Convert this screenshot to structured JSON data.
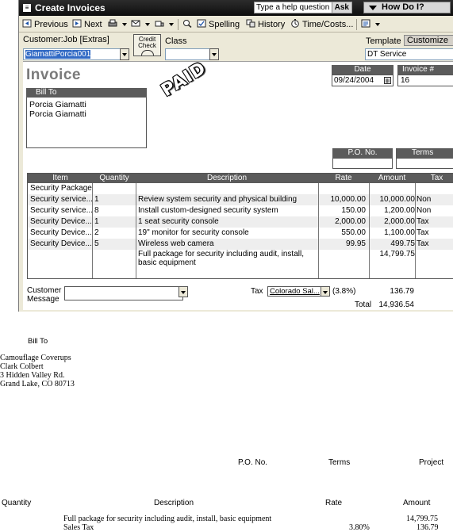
{
  "window": {
    "title": "Create Invoices",
    "help_placeholder": "Type a help question",
    "ask_label": "Ask",
    "how_do_i_label": "How Do I?"
  },
  "toolbar": {
    "previous_label": "Previous",
    "next_label": "Next",
    "spelling_label": "Spelling",
    "history_label": "History",
    "time_costs_label": "Time/Costs..."
  },
  "header": {
    "customer_job_label": "Customer:Job",
    "extras_label": "[Extras]",
    "class_label": "Class",
    "template_label": "Template",
    "template_button": "Customize",
    "customer_job_value": "GiamattiPorcia001",
    "class_value": "",
    "template_value": "DT Service",
    "credit_check_label": "Credit Check"
  },
  "form": {
    "title": "Invoice",
    "stamp": "PAID",
    "bill_to_label": "Bill To",
    "bill_to_lines": [
      "Porcia Giamatti",
      "Porcia Giamatti"
    ],
    "date_label": "Date",
    "date_value": "09/24/2004",
    "invoice_no_label": "Invoice #",
    "invoice_no_value": "16",
    "po_label": "P.O. No.",
    "terms_label": "Terms"
  },
  "grid": {
    "headers": {
      "item": "Item",
      "quantity": "Quantity",
      "description": "Description",
      "rate": "Rate",
      "amount": "Amount",
      "tax": "Tax"
    },
    "rows": [
      {
        "item": "Security Package",
        "qty": "",
        "desc": "",
        "rate": "",
        "amount": "",
        "tax": ""
      },
      {
        "item": "Security service...",
        "qty": "1",
        "desc": "Review system security and physical building",
        "rate": "10,000.00",
        "amount": "10,000.00",
        "tax": "Non"
      },
      {
        "item": "Security service...",
        "qty": "8",
        "desc": "Install custom-designed security system",
        "rate": "150.00",
        "amount": "1,200.00",
        "tax": "Non"
      },
      {
        "item": "Security Device...",
        "qty": "1",
        "desc": "1 seat security console",
        "rate": "2,000.00",
        "amount": "2,000.00",
        "tax": "Tax"
      },
      {
        "item": "Security Device...",
        "qty": "2",
        "desc": "19\" monitor for security console",
        "rate": "550.00",
        "amount": "1,100.00",
        "tax": "Tax"
      },
      {
        "item": "Security Device...",
        "qty": "5",
        "desc": "Wireless web camera",
        "rate": "99.95",
        "amount": "499.75",
        "tax": "Tax"
      }
    ],
    "package_desc": "Full package for security including audit, install, basic equipment",
    "package_amount": "14,799.75"
  },
  "footer": {
    "customer_message_label_1": "Customer",
    "customer_message_label_2": "Message",
    "tax_label": "Tax",
    "tax_item": "Colorado Sal...",
    "tax_rate": "(3.8%)",
    "tax_amount": "136.79",
    "total_label": "Total",
    "total_amount": "14,936.54"
  },
  "printed": {
    "bill_to_label": "Bill To",
    "address_lines": [
      "Camouflage Coverups",
      "Clark Colbert",
      "3 Hidden Valley Rd.",
      "Grand Lake, CO 80713"
    ],
    "po_label": "P.O. No.",
    "terms_label": "Terms",
    "project_label": "Project",
    "quantity_label": "Quantity",
    "description_label": "Description",
    "rate_label": "Rate",
    "amount_label": "Amount",
    "line1_desc": "Full package for security including audit, install, basic equipment",
    "line1_amount": "14,799.75",
    "line2_desc": "Sales Tax",
    "line2_rate": "3.80%",
    "line2_amount": "136.79"
  }
}
